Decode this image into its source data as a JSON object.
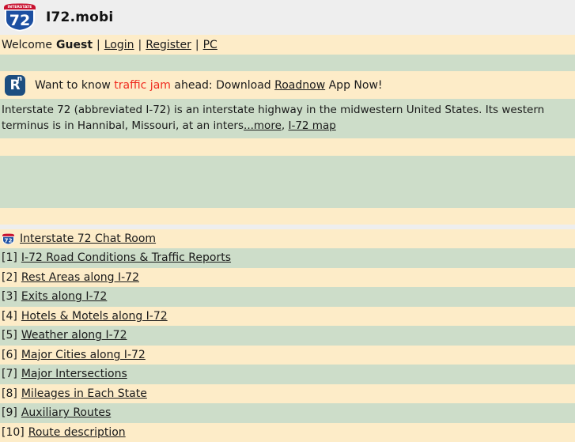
{
  "header": {
    "shield_icon": "interstate-72-shield-icon",
    "shield_banner": "INTERSTATE",
    "shield_number": "72",
    "site_title": "I72.mobi"
  },
  "welcome": {
    "greeting": "Welcome",
    "user": "Guest",
    "sep": "|",
    "login_label": "Login",
    "register_label": "Register",
    "pc_label": "PC"
  },
  "ad": {
    "badge_letter": "R",
    "badge_sup": "n",
    "text_before": "Want to know",
    "highlight": "traffic jam",
    "text_middle": "ahead: Download",
    "app_link": "Roadnow",
    "text_after": "App Now!",
    "highlight_color": "#ef2b1f"
  },
  "description": {
    "body": "Interstate 72 (abbreviated I-72) is an interstate highway in the midwestern United States. Its western terminus is in Hannibal, Missouri, at an inters",
    "more_link": "...more",
    "comma": ",",
    "map_link": "I-72 map"
  },
  "chat": {
    "shield_icon": "interstate-72-shield-icon-small",
    "label": "Interstate 72 Chat Room"
  },
  "list": [
    {
      "index": "[1]",
      "label": "I-72 Road Conditions & Traffic Reports"
    },
    {
      "index": "[2]",
      "label": "Rest Areas along I-72"
    },
    {
      "index": "[3]",
      "label": "Exits along I-72"
    },
    {
      "index": "[4]",
      "label": "Hotels & Motels along I-72"
    },
    {
      "index": "[5]",
      "label": "Weather along I-72"
    },
    {
      "index": "[6]",
      "label": "Major Cities along I-72"
    },
    {
      "index": "[7]",
      "label": "Major Intersections"
    },
    {
      "index": "[8]",
      "label": "Mileages in Each State"
    },
    {
      "index": "[9]",
      "label": "Auxiliary Routes"
    },
    {
      "index": "[10]",
      "label": "Route description"
    }
  ],
  "colors": {
    "cream": "#fdecc8",
    "green": "#cdddc9",
    "gray": "#eeeeee",
    "shield_blue": "#1c4fa1",
    "shield_red": "#c8102e",
    "badge_blue": "#1d4e80"
  }
}
